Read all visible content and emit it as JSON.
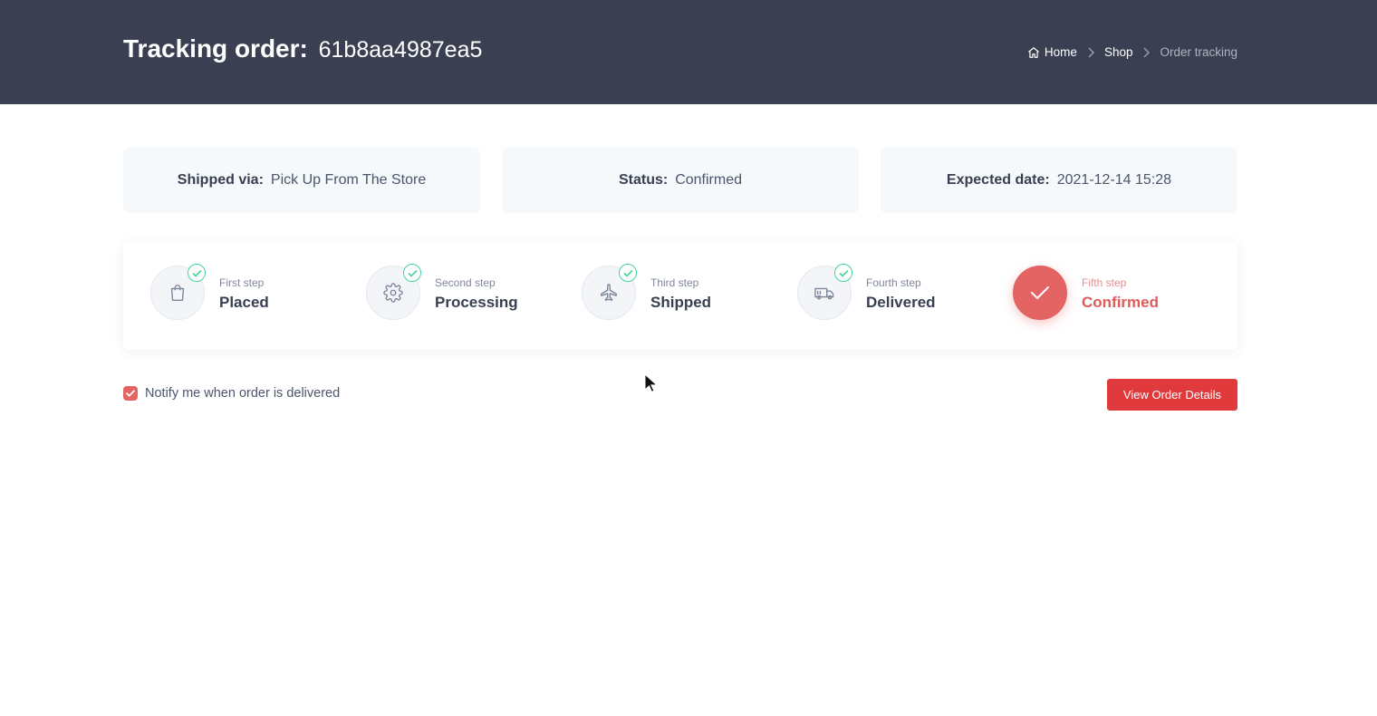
{
  "header": {
    "title_label": "Tracking order:",
    "order_id": "61b8aa4987ea5",
    "breadcrumb": [
      {
        "label": "Home",
        "icon": "home-icon"
      },
      {
        "label": "Shop"
      },
      {
        "label": "Order tracking"
      }
    ]
  },
  "info": [
    {
      "label": "Shipped via:",
      "value": "Pick Up From The Store"
    },
    {
      "label": "Status:",
      "value": "Confirmed"
    },
    {
      "label": "Expected date:",
      "value": "2021-12-14 15:28"
    }
  ],
  "steps": [
    {
      "sub": "First step",
      "title": "Placed",
      "icon": "shopping-bag-icon",
      "completed": true
    },
    {
      "sub": "Second step",
      "title": "Processing",
      "icon": "gear-icon",
      "completed": true
    },
    {
      "sub": "Third step",
      "title": "Shipped",
      "icon": "airplane-icon",
      "completed": true
    },
    {
      "sub": "Fourth step",
      "title": "Delivered",
      "icon": "truck-icon",
      "completed": true
    },
    {
      "sub": "Fifth step",
      "title": "Confirmed",
      "icon": "check-icon",
      "active": true
    }
  ],
  "notify": {
    "label": "Notify me when order is delivered",
    "checked": true
  },
  "actions": {
    "view_details_label": "View Order Details"
  },
  "colors": {
    "header_bg": "#3a4051",
    "accent": "#e46464",
    "button": "#e03a3c",
    "success": "#42d697",
    "card_bg": "#f6f9fc"
  }
}
